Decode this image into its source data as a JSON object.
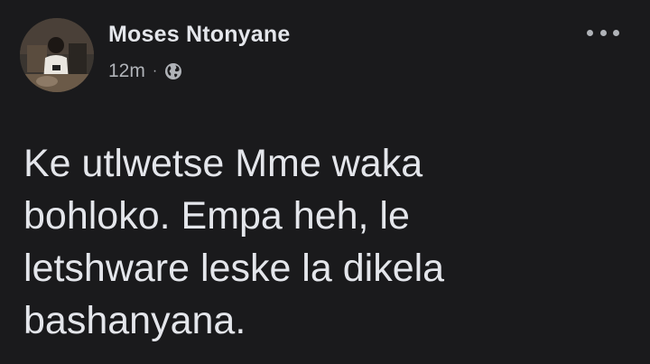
{
  "post": {
    "author": "Moses Ntonyane",
    "time": "12m",
    "separator": "·",
    "privacy_icon": "globe-icon",
    "more_icon": "more-options-icon",
    "text_lines": [
      "Ke utlwetse Mme waka",
      "bohloko.  Empa heh, le",
      "letshware leske la dikela",
      "bashanyana."
    ]
  },
  "colors": {
    "background": "#1a1a1c",
    "primary_text": "#e4e6eb",
    "secondary_text": "#b0b3b8"
  }
}
